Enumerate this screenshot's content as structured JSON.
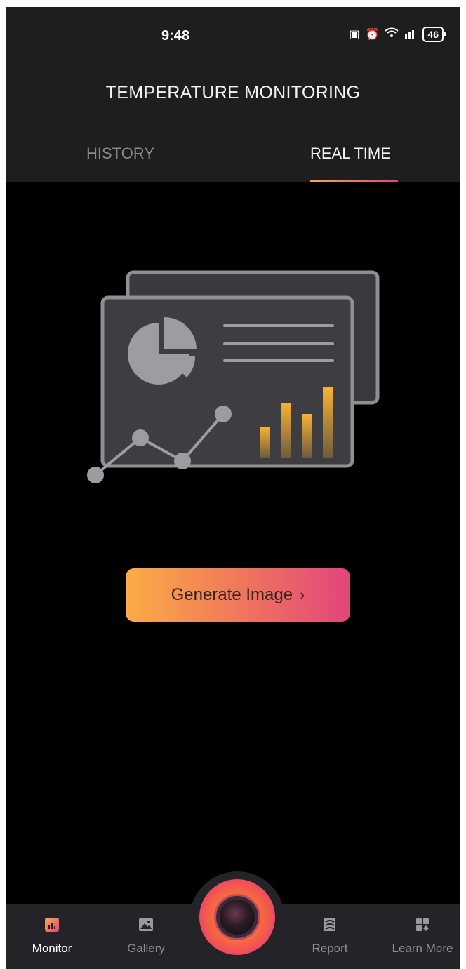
{
  "status_bar": {
    "time": "9:48",
    "icons": [
      "nfc-icon",
      "alarm-icon",
      "wifi-icon",
      "signal-icon"
    ],
    "battery": "46"
  },
  "header": {
    "title": "TEMPERATURE MONITORING"
  },
  "tabs": [
    {
      "label": "HISTORY",
      "active": false
    },
    {
      "label": "REAL TIME",
      "active": true
    }
  ],
  "main": {
    "generate_button": {
      "label": "Generate Image",
      "chevron": "›"
    }
  },
  "bottom_nav": {
    "items": [
      {
        "label": "Monitor",
        "icon": "bar-chart-icon",
        "active": true
      },
      {
        "label": "Gallery",
        "icon": "image-icon",
        "active": false
      },
      {
        "label": "Report",
        "icon": "report-icon",
        "active": false
      },
      {
        "label": "Learn More",
        "icon": "grid-icon",
        "active": false
      }
    ],
    "center_action": {
      "icon": "camera-lens-icon"
    }
  },
  "colors": {
    "accent_start": "#fbac47",
    "accent_end": "#e2457d",
    "header_bg": "#1e1e21",
    "nav_bg": "#242428"
  }
}
